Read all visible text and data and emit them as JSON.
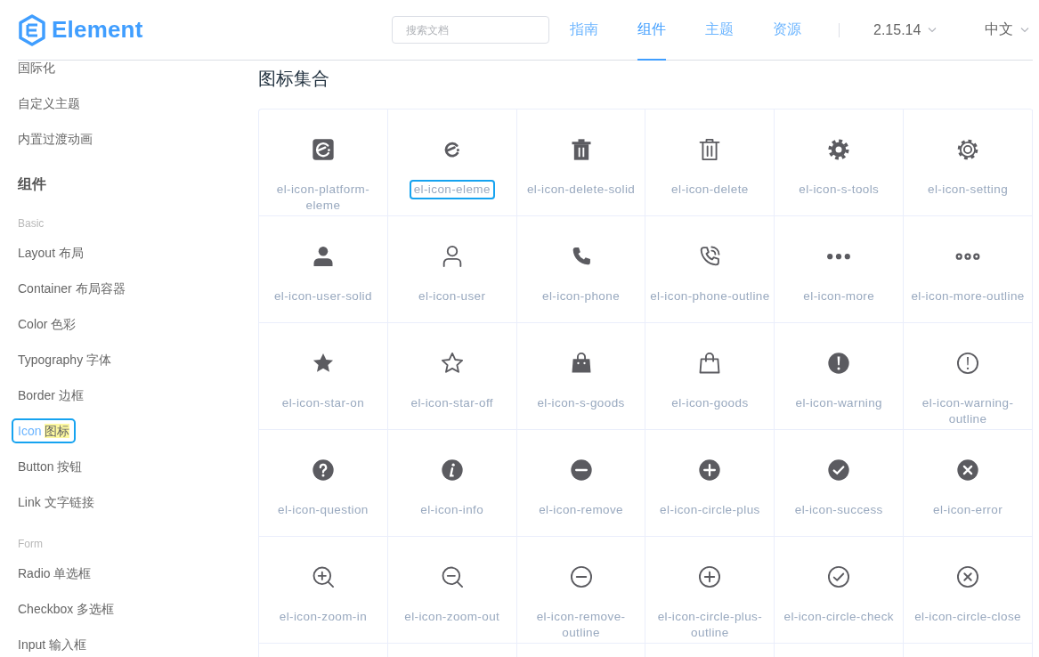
{
  "header": {
    "logo_text": "Element",
    "search": {
      "placeholder": "搜索文档"
    },
    "nav": [
      {
        "label": "指南",
        "selected": false
      },
      {
        "label": "组件",
        "selected": true
      },
      {
        "label": "主题",
        "selected": false
      },
      {
        "label": "资源",
        "selected": false
      }
    ],
    "version": "2.15.14",
    "language": "中文"
  },
  "sidebar": {
    "entries": [
      {
        "kind": "link",
        "label": "国际化",
        "selected": false
      },
      {
        "kind": "link",
        "label": "自定义主题",
        "selected": false
      },
      {
        "kind": "link",
        "label": "内置过渡动画",
        "selected": false
      },
      {
        "kind": "heading",
        "label": "组件"
      },
      {
        "kind": "group",
        "label": "Basic"
      },
      {
        "kind": "link",
        "label": "Layout 布局",
        "selected": false
      },
      {
        "kind": "link",
        "label": "Container 布局容器",
        "selected": false
      },
      {
        "kind": "link",
        "label": "Color 色彩",
        "selected": false
      },
      {
        "kind": "link",
        "label": "Typography 字体",
        "selected": false
      },
      {
        "kind": "link",
        "label": "Border 边框",
        "selected": false
      },
      {
        "kind": "link",
        "label": "Icon",
        "highlight": "图标",
        "selected": true,
        "outlined": true
      },
      {
        "kind": "link",
        "label": "Button 按钮",
        "selected": false
      },
      {
        "kind": "link",
        "label": "Link 文字链接",
        "selected": false
      },
      {
        "kind": "group",
        "label": "Form"
      },
      {
        "kind": "link",
        "label": "Radio 单选框",
        "selected": false
      },
      {
        "kind": "link",
        "label": "Checkbox 多选框",
        "selected": false
      },
      {
        "kind": "link",
        "label": "Input 输入框",
        "selected": false
      }
    ]
  },
  "main": {
    "title": "图标集合",
    "icons": [
      {
        "name": "el-icon-platform-eleme",
        "outlined": false
      },
      {
        "name": "el-icon-eleme",
        "outlined": true
      },
      {
        "name": "el-icon-delete-solid",
        "outlined": false
      },
      {
        "name": "el-icon-delete",
        "outlined": false
      },
      {
        "name": "el-icon-s-tools",
        "outlined": false
      },
      {
        "name": "el-icon-setting",
        "outlined": false
      },
      {
        "name": "el-icon-user-solid",
        "outlined": false
      },
      {
        "name": "el-icon-user",
        "outlined": false
      },
      {
        "name": "el-icon-phone",
        "outlined": false
      },
      {
        "name": "el-icon-phone-outline",
        "outlined": false
      },
      {
        "name": "el-icon-more",
        "outlined": false
      },
      {
        "name": "el-icon-more-outline",
        "outlined": false
      },
      {
        "name": "el-icon-star-on",
        "outlined": false
      },
      {
        "name": "el-icon-star-off",
        "outlined": false
      },
      {
        "name": "el-icon-s-goods",
        "outlined": false
      },
      {
        "name": "el-icon-goods",
        "outlined": false
      },
      {
        "name": "el-icon-warning",
        "outlined": false
      },
      {
        "name": "el-icon-warning-outline",
        "outlined": false
      },
      {
        "name": "el-icon-question",
        "outlined": false
      },
      {
        "name": "el-icon-info",
        "outlined": false
      },
      {
        "name": "el-icon-remove",
        "outlined": false
      },
      {
        "name": "el-icon-circle-plus",
        "outlined": false
      },
      {
        "name": "el-icon-success",
        "outlined": false
      },
      {
        "name": "el-icon-error",
        "outlined": false
      },
      {
        "name": "el-icon-zoom-in",
        "outlined": false
      },
      {
        "name": "el-icon-zoom-out",
        "outlined": false
      },
      {
        "name": "el-icon-remove-outline",
        "outlined": false
      },
      {
        "name": "el-icon-circle-plus-outline",
        "outlined": false
      },
      {
        "name": "el-icon-circle-check",
        "outlined": false
      },
      {
        "name": "el-icon-circle-close",
        "outlined": false
      }
    ]
  }
}
